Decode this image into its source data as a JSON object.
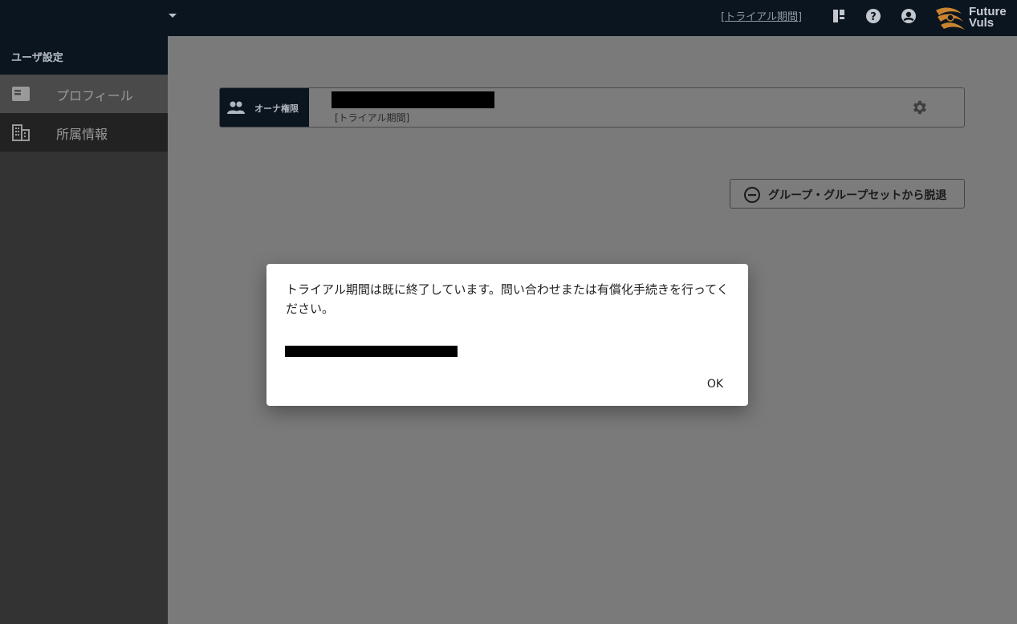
{
  "header": {
    "trial_link": "[トライアル期間]",
    "logo_text_line1": "Future",
    "logo_text_line2": "Vuls",
    "icons": [
      "dropdown-caret-icon",
      "board-icon",
      "help-icon",
      "account-icon"
    ]
  },
  "sidebar": {
    "title": "ユーザ設定",
    "items": [
      {
        "label": "プロフィール",
        "icon": "profile-card-icon"
      },
      {
        "label": "所属情報",
        "icon": "building-icon"
      }
    ]
  },
  "card": {
    "role": "オーナ権限",
    "subtitle": "[トライアル期間]",
    "role_icon": "group-icon",
    "settings_icon": "gear-icon"
  },
  "leave_button": {
    "label": "グループ・グループセットから脱退",
    "icon": "minus-circle-icon"
  },
  "dialog": {
    "message": "トライアル期間は既に終了しています。問い合わせまたは有償化手続きを行ってください。",
    "ok": "OK"
  },
  "colors": {
    "header_bg": "#0b1520",
    "sidebar_bg": "#333333",
    "overlay": "#777777",
    "logo_accent": "#c8842e"
  }
}
